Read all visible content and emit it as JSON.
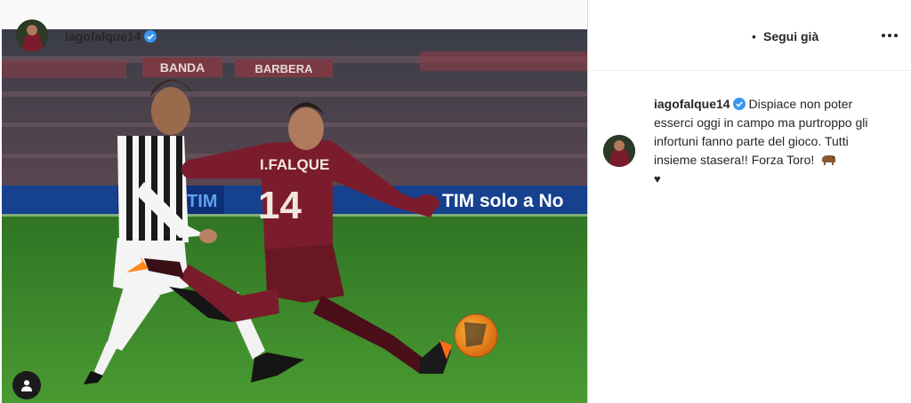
{
  "post": {
    "username": "iagofalque14",
    "dot": "•",
    "follow_label": "Segui già",
    "caption_text": "Dispiace non poter esserci oggi in campo ma purtroppo gli infortuni fanno parte del gioco. Tutti insieme stasera!! Forza Toro!",
    "caption_emojis": [
      "bear-emoji",
      "black-heart-emoji"
    ],
    "heart_glyph": "♥"
  },
  "photo": {
    "stadium_banners": [
      "BANDA",
      "BARBERA"
    ],
    "ad_board_left": "TIM",
    "ad_board_right": "TIM solo a No",
    "player_left_name": "",
    "player_right_name": "I.FALQUE",
    "player_right_number": "14"
  },
  "icons": {
    "verified": "verified-badge-icon",
    "more": "more-options-icon",
    "tag": "user-tag-icon"
  },
  "colors": {
    "verified_blue": "#3897f0",
    "torino_maroon": "#7b1c2c",
    "pitch_green": "#3e8a2a",
    "text": "#262626",
    "border": "#dbdbdb"
  }
}
